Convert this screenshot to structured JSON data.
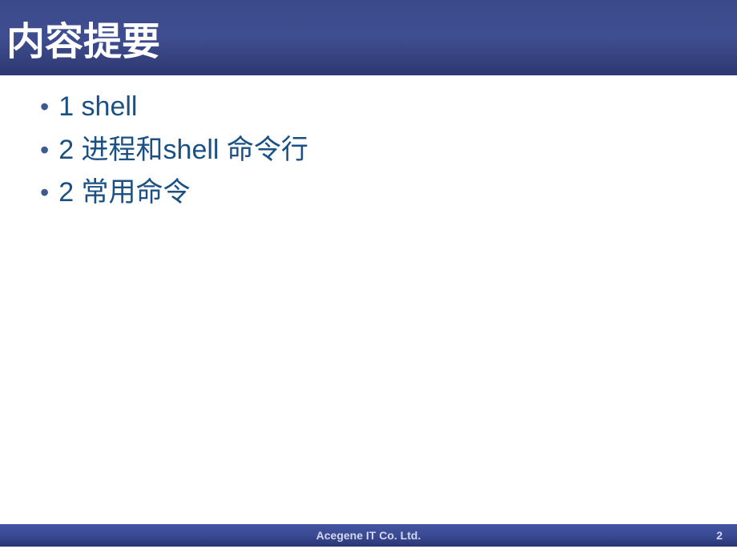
{
  "title": "内容提要",
  "bullets": [
    "1 shell",
    "2 进程和shell 命令行",
    "2 常用命令"
  ],
  "footer": {
    "company": "Acegene IT Co. Ltd.",
    "page_number": "2"
  }
}
